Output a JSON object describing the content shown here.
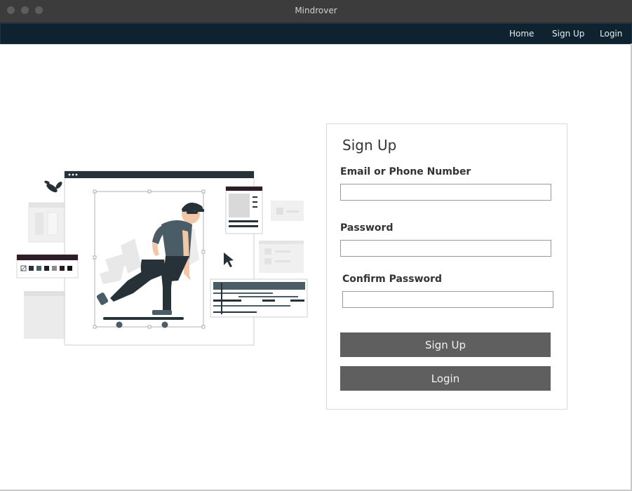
{
  "window": {
    "title": "Mindrover"
  },
  "nav": {
    "home": "Home",
    "signup": "Sign Up",
    "login": "Login"
  },
  "form": {
    "title": "Sign Up",
    "email_label": "Email or Phone Number",
    "email_value": "",
    "password_label": "Password",
    "password_value": "",
    "confirm_label": "Confirm Password",
    "confirm_value": "",
    "signup_button": "Sign Up",
    "login_button": "Login"
  },
  "colors": {
    "navbar": "#0e2230",
    "button": "#5f5f5f",
    "titlebar": "#3c3c3c"
  }
}
